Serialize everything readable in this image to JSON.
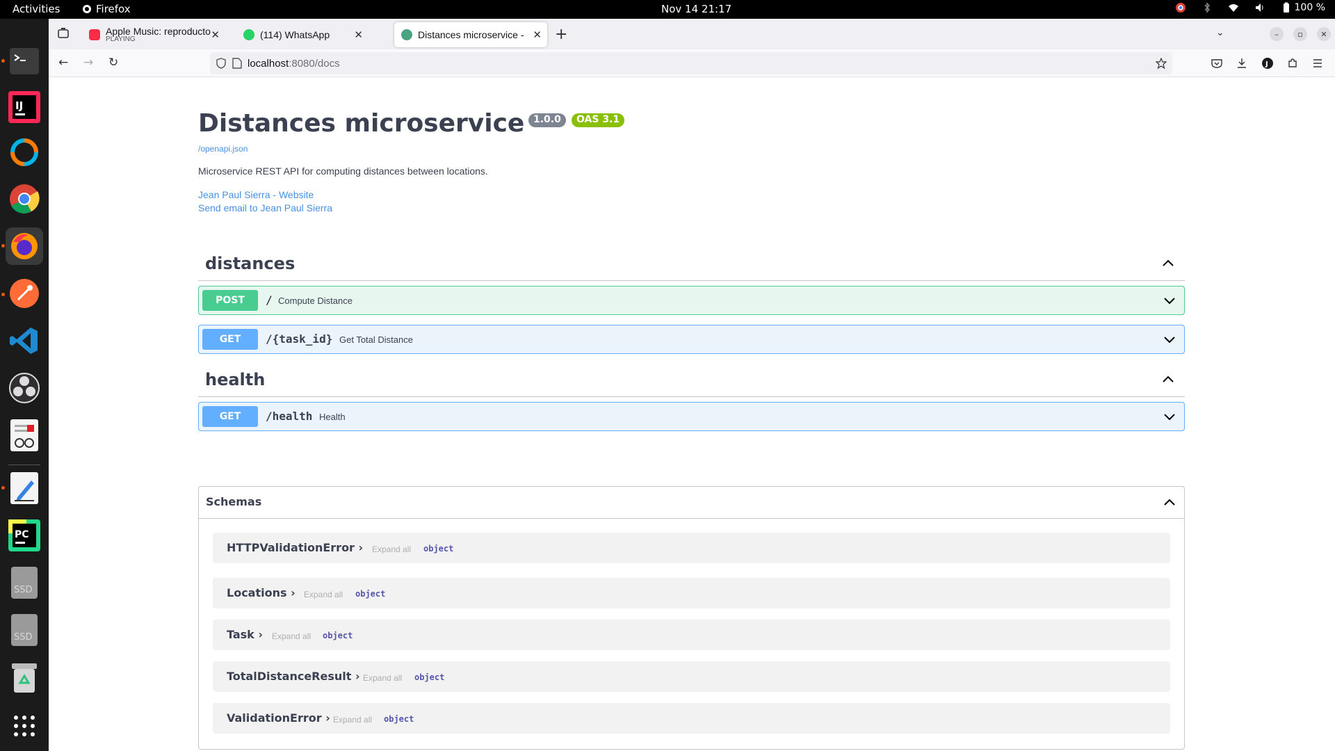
{
  "system": {
    "activities": "Activities",
    "app_name": "Firefox",
    "clock": "Nov 14  21:17",
    "battery": "100 %"
  },
  "browser": {
    "tabs": [
      {
        "title": "Apple Music: reproducto",
        "subtitle": "PLAYING"
      },
      {
        "title": "(114) WhatsApp"
      },
      {
        "title": "Distances microservice -"
      }
    ],
    "url_host": "localhost",
    "url_rest": ":8080/docs"
  },
  "info": {
    "title": "Distances microservice",
    "version": "1.0.0",
    "oas": "OAS 3.1",
    "openapi_link": "/openapi.json",
    "description": "Microservice REST API for computing distances between locations.",
    "website_link": "Jean Paul Sierra - Website",
    "email_link": "Send email to Jean Paul Sierra"
  },
  "tags": [
    {
      "name": "distances",
      "operations": [
        {
          "method": "POST",
          "path": "/",
          "summary": "Compute Distance"
        },
        {
          "method": "GET",
          "path": "/{task_id}",
          "summary": "Get Total Distance"
        }
      ]
    },
    {
      "name": "health",
      "operations": [
        {
          "method": "GET",
          "path": "/health",
          "summary": "Health"
        }
      ]
    }
  ],
  "schemas": {
    "title": "Schemas",
    "expand_label": "Expand all",
    "type_label": "object",
    "models": [
      {
        "name": "HTTPValidationError"
      },
      {
        "name": "Locations"
      },
      {
        "name": "Task"
      },
      {
        "name": "TotalDistanceResult"
      },
      {
        "name": "ValidationError"
      }
    ]
  },
  "colors": {
    "post": "#49cc90",
    "post_bg": "#e8f6f0",
    "get": "#61affe",
    "get_bg": "#ebf3fb",
    "version_badge": "#7d8492",
    "oas_badge": "#89bf04",
    "link": "#4990e2"
  }
}
